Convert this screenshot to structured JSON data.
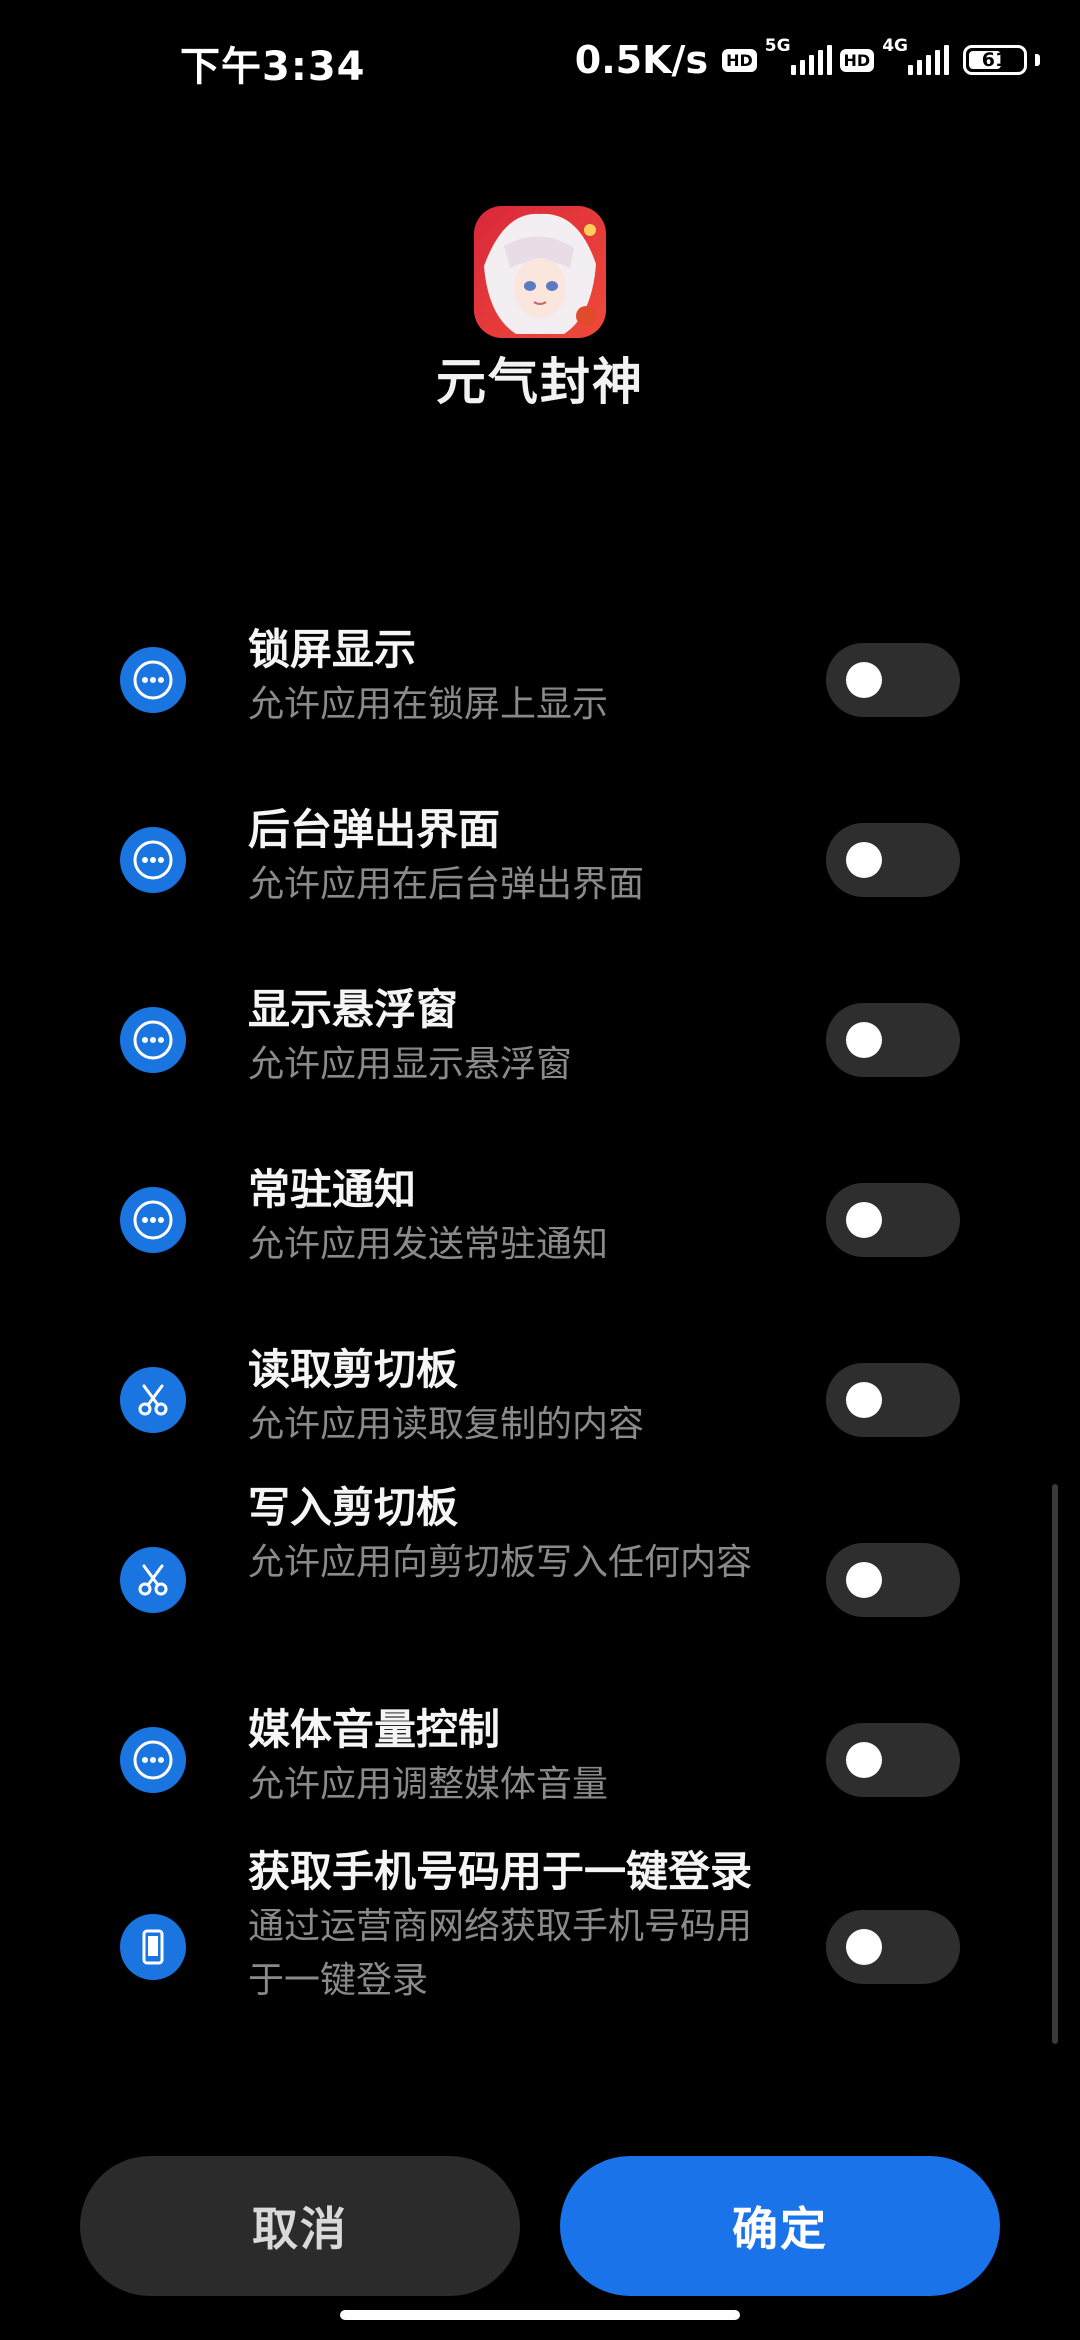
{
  "status_bar": {
    "time": "下午3:34",
    "net_speed": "0.5K/s",
    "sim1": {
      "hd": "HD",
      "network": "5G"
    },
    "sim2": {
      "hd": "HD",
      "network": "4G"
    },
    "battery_level": "61"
  },
  "app": {
    "name": "元气封神",
    "icon": "app-icon-character"
  },
  "permissions": [
    {
      "icon": "more-dots-icon",
      "title": "锁屏显示",
      "desc": "允许应用在锁屏上显示",
      "enabled": false
    },
    {
      "icon": "more-dots-icon",
      "title": "后台弹出界面",
      "desc": "允许应用在后台弹出界面",
      "enabled": false
    },
    {
      "icon": "more-dots-icon",
      "title": "显示悬浮窗",
      "desc": "允许应用显示悬浮窗",
      "enabled": false
    },
    {
      "icon": "more-dots-icon",
      "title": "常驻通知",
      "desc": "允许应用发送常驻通知",
      "enabled": false
    },
    {
      "icon": "scissors-icon",
      "title": "读取剪切板",
      "desc": "允许应用读取复制的内容",
      "enabled": false
    },
    {
      "icon": "scissors-icon",
      "title": "写入剪切板",
      "desc": "允许应用向剪切板写入任何内容",
      "enabled": false
    },
    {
      "icon": "more-dots-icon",
      "title": "媒体音量控制",
      "desc": "允许应用调整媒体音量",
      "enabled": false
    },
    {
      "icon": "phone-icon",
      "title": "获取手机号码用于一键登录",
      "desc": "通过运营商网络获取手机号码用于一键登录",
      "enabled": false
    }
  ],
  "buttons": {
    "cancel": "取消",
    "confirm": "确定"
  },
  "colors": {
    "accent": "#1a73e8",
    "icon_bg": "#1a75e0",
    "toggle_off": "#2e2e2e"
  }
}
